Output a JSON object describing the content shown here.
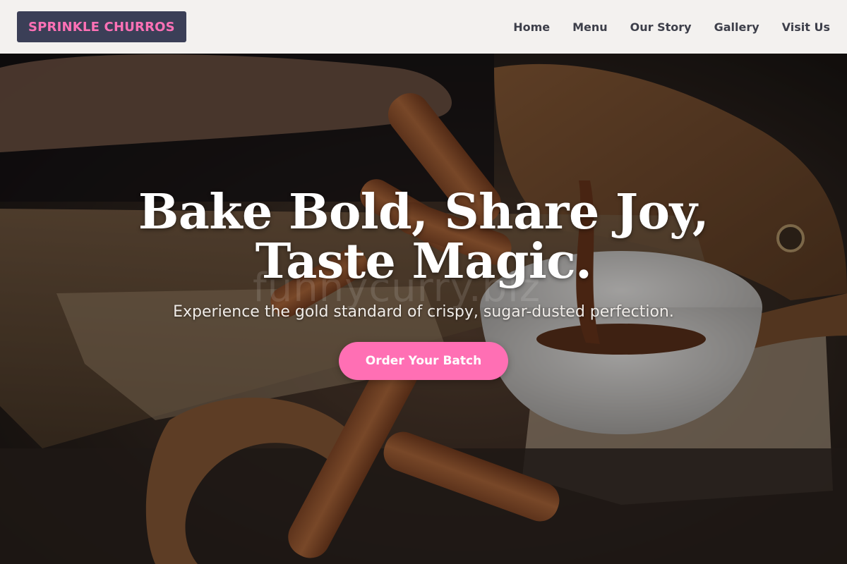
{
  "brand": {
    "name": "SPRINKLE CHURROS",
    "accent_color": "#ff71b6",
    "logo_bg_color": "#3b3f57"
  },
  "nav": {
    "items": [
      {
        "label": "Home"
      },
      {
        "label": "Menu"
      },
      {
        "label": "Our Story"
      },
      {
        "label": "Gallery"
      },
      {
        "label": "Visit Us"
      }
    ]
  },
  "hero": {
    "headline_line1": "Bake Bold, Share Joy,",
    "headline_line2": "Taste Magic.",
    "subheadline": "Experience the gold standard of crispy, sugar-dusted perfection.",
    "cta_label": "Order Your Batch",
    "cta_color": "#ff6fb4",
    "watermark": "funnycurry.biz",
    "background_image": "churros-with-chocolate-sauce-photo"
  }
}
